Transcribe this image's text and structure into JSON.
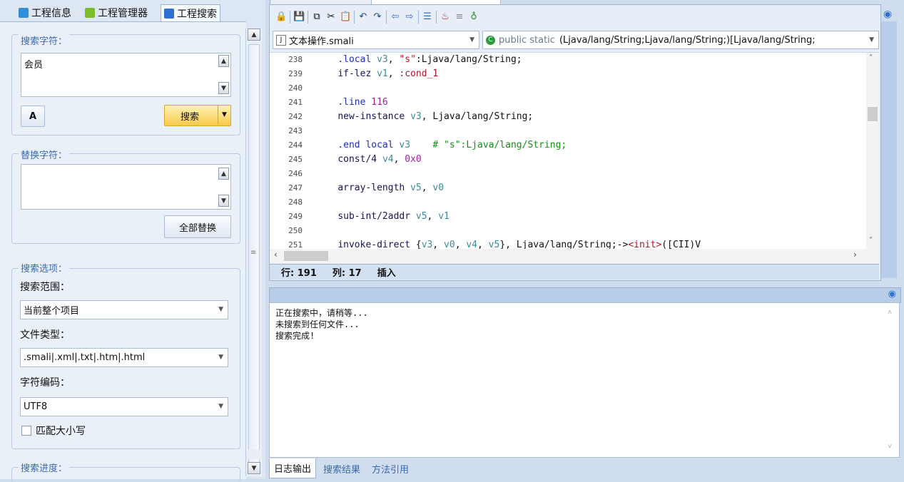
{
  "left_tabs": [
    {
      "label": "工程信息",
      "icon": "info-icon"
    },
    {
      "label": "工程管理器",
      "icon": "android-icon"
    },
    {
      "label": "工程搜索",
      "icon": "search-icon"
    }
  ],
  "search": {
    "group_title": "搜索字符：",
    "query": "会员",
    "search_button": "搜索",
    "font_icon": "font-icon"
  },
  "replace": {
    "group_title": "替换字符：",
    "value": "",
    "replace_all_button": "全部替换"
  },
  "options": {
    "group_title": "搜索选项：",
    "scope_label": "搜索范围：",
    "scope_value": "当前整个项目",
    "filetype_label": "文件类型：",
    "filetype_value": ".smali|.xml|.txt|.htm|.html",
    "encoding_label": "字符编码：",
    "encoding_value": "UTF8",
    "match_case_label": "匹配大小写"
  },
  "progress": {
    "group_title": "搜索进度："
  },
  "editor": {
    "file_combo": "文本操作.smali",
    "method_combo_prefix": "public static",
    "method_combo_signature": "(Ljava/lang/String;Ljava/lang/String;)[Ljava/lang/String;",
    "lines": [
      {
        "n": "238",
        "html": "    <span class='dir'>.local</span> <span class='rg'>v3</span>, <span class='st'>\"s\"</span>:Ljava/lang/String;"
      },
      {
        "n": "239",
        "html": "    <span class='kw'>if-lez</span> <span class='rg'>v1</span>, <span class='lb'>:cond_1</span>"
      },
      {
        "n": "240",
        "html": ""
      },
      {
        "n": "241",
        "html": "    <span class='dir'>.line</span> <span class='nm'>116</span>"
      },
      {
        "n": "242",
        "html": "    <span class='kw'>new-instance</span> <span class='rg'>v3</span>, Ljava/lang/String;"
      },
      {
        "n": "243",
        "html": ""
      },
      {
        "n": "244",
        "html": "    <span class='dir'>.end local</span> <span class='rg'>v3</span>    <span class='cm'># \"s\":Ljava/lang/String;</span>"
      },
      {
        "n": "245",
        "html": "    <span class='kw'>const/4</span> <span class='rg'>v4</span>, <span class='nm'>0x0</span>"
      },
      {
        "n": "246",
        "html": ""
      },
      {
        "n": "247",
        "html": "    <span class='kw'>array-length</span> <span class='rg'>v5</span>, <span class='rg'>v0</span>"
      },
      {
        "n": "248",
        "html": ""
      },
      {
        "n": "249",
        "html": "    <span class='kw'>sub-int/2addr</span> <span class='rg'>v5</span>, <span class='rg'>v1</span>"
      },
      {
        "n": "250",
        "html": ""
      },
      {
        "n": "251",
        "html": "    <span class='kw'>invoke-direct</span> {<span class='rg'>v3</span>, <span class='rg'>v0</span>, <span class='rg'>v4</span>, <span class='rg'>v5</span>}, Ljava/lang/String;-&gt;<span class='lb'>&lt;init&gt;</span>([CII)V"
      }
    ],
    "status_row": "行: 191",
    "status_col": "列: 17",
    "status_mode": "插入"
  },
  "log": {
    "lines": [
      "正在搜索中，请稍等...",
      "未搜索到任何文件...",
      "搜索完成!"
    ]
  },
  "bottom_tabs": [
    "日志输出",
    "搜索结果",
    "方法引用"
  ]
}
